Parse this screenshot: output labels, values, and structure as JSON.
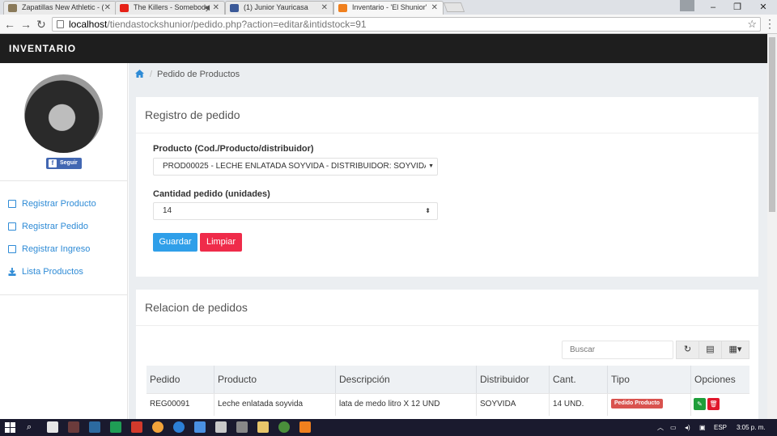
{
  "browser": {
    "tabs": [
      {
        "title": "Zapatillas New Athletic - ("
      },
      {
        "title": "The Killers - Somebody"
      },
      {
        "title": "(1) Junior Yauricasa"
      },
      {
        "title": "Inventario - 'El Shunior'"
      }
    ],
    "url_host": "localhost",
    "url_path": "/tiendastockshunior/pedido.php?action=editar&intidstock=91"
  },
  "app": {
    "brand": "INVENTARIO"
  },
  "sidebar": {
    "follow_label": "Seguir",
    "items": [
      {
        "label": "Registrar Producto"
      },
      {
        "label": "Registrar Pedido"
      },
      {
        "label": "Registrar Ingreso"
      },
      {
        "label": "Lista Productos"
      }
    ]
  },
  "breadcrumb": {
    "separator": "/",
    "current": "Pedido de Productos"
  },
  "form": {
    "title": "Registro de pedido",
    "product_label": "Producto (Cod./Producto/distribuidor)",
    "product_value": "PROD00025 - LECHE ENLATADA SOYVIDA - DISTRIBUIDOR: SOYVIDA",
    "qty_label": "Cantidad pedido (unidades)",
    "qty_value": "14",
    "save_label": "Guardar",
    "clear_label": "Limpiar"
  },
  "list": {
    "title": "Relacion de pedidos",
    "search_placeholder": "Buscar",
    "columns": [
      "Pedido",
      "Producto",
      "Descripción",
      "Distribuidor",
      "Cant.",
      "Tipo",
      "Opciones"
    ],
    "rows": [
      {
        "pedido": "REG00091",
        "producto": "Leche enlatada soyvida",
        "descripcion": "lata de medo litro X 12 UND",
        "distribuidor": "SOYVIDA",
        "cantidad": "14 UND.",
        "tipo": "Pedido Producto"
      }
    ]
  },
  "taskbar": {
    "lang": "ESP",
    "time": "3:05 p. m."
  },
  "colors": {
    "header_bg": "#1e1e1e",
    "link": "#2e8bd6",
    "primary": "#2f9fe9",
    "danger": "#ef2b4a",
    "badge": "#d9534f",
    "edit": "#1e9e3a"
  }
}
